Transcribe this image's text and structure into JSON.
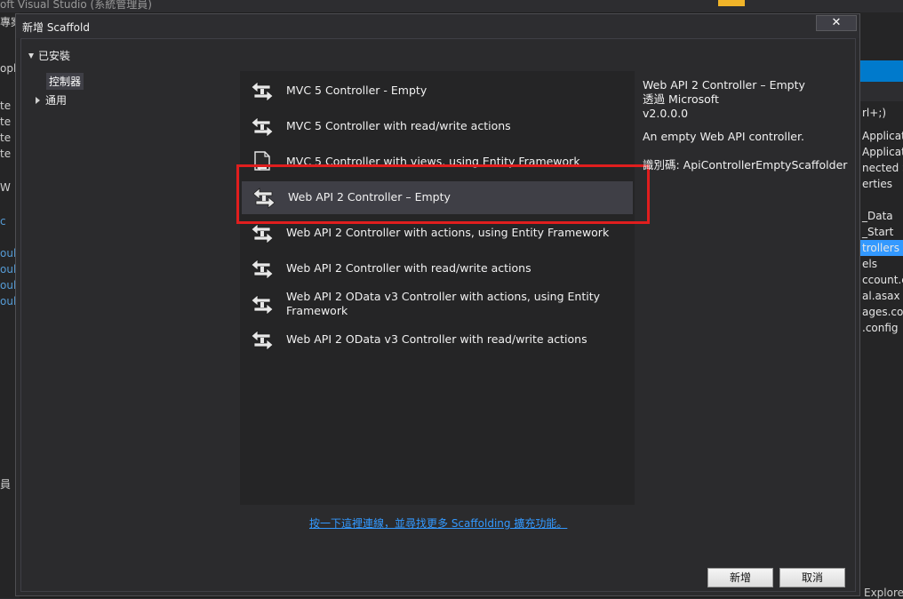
{
  "ide": {
    "title": "oft Visual Studio (系統管理員)",
    "left_fragments": [
      "專案",
      "opl",
      "te",
      "te",
      "te",
      "te",
      "W",
      "c",
      "oub",
      "oub",
      "oub",
      "oub",
      "員"
    ],
    "right_fragments": [
      "rl+;)",
      "Applicati",
      "Applicati",
      "nected S",
      "erties",
      "_Data",
      "_Start",
      "trollers",
      "els",
      "ccount.c",
      "al.asax",
      "ages.co",
      ".config"
    ],
    "bottom_right": "Explore"
  },
  "dialog": {
    "title": "新增 Scaffold",
    "close_label": "✕",
    "tree": {
      "installed": "已安裝",
      "controller": "控制器",
      "general": "通用"
    },
    "items": [
      {
        "label": "MVC 5 Controller - Empty",
        "icon": "controller-icon"
      },
      {
        "label": "MVC 5 Controller with read/write actions",
        "icon": "controller-icon"
      },
      {
        "label": "MVC 5 Controller with views, using Entity Framework",
        "icon": "document-controller-icon"
      },
      {
        "label": "Web API 2 Controller – Empty",
        "icon": "controller-icon"
      },
      {
        "label": "Web API 2 Controller with actions, using Entity Framework",
        "icon": "controller-icon"
      },
      {
        "label": "Web API 2 Controller with read/write actions",
        "icon": "controller-icon"
      },
      {
        "label": "Web API 2 OData v3 Controller with actions, using Entity Framework",
        "icon": "controller-icon"
      },
      {
        "label": "Web API 2 OData v3 Controller with read/write actions",
        "icon": "controller-icon"
      }
    ],
    "selected_index": 3,
    "details": {
      "name": "Web API 2 Controller – Empty",
      "by": "透過 Microsoft",
      "version": "v2.0.0.0",
      "description": "An empty Web API controller.",
      "id": "識別碼: ApiControllerEmptyScaffolder"
    },
    "more_link": "按一下這裡連線，並尋找更多 Scaffolding 擴充功能。",
    "add_label": "新增",
    "cancel_label": "取消"
  },
  "colors": {
    "highlight": "#e01e1e",
    "link": "#3399ff",
    "accent": "#007acc"
  }
}
